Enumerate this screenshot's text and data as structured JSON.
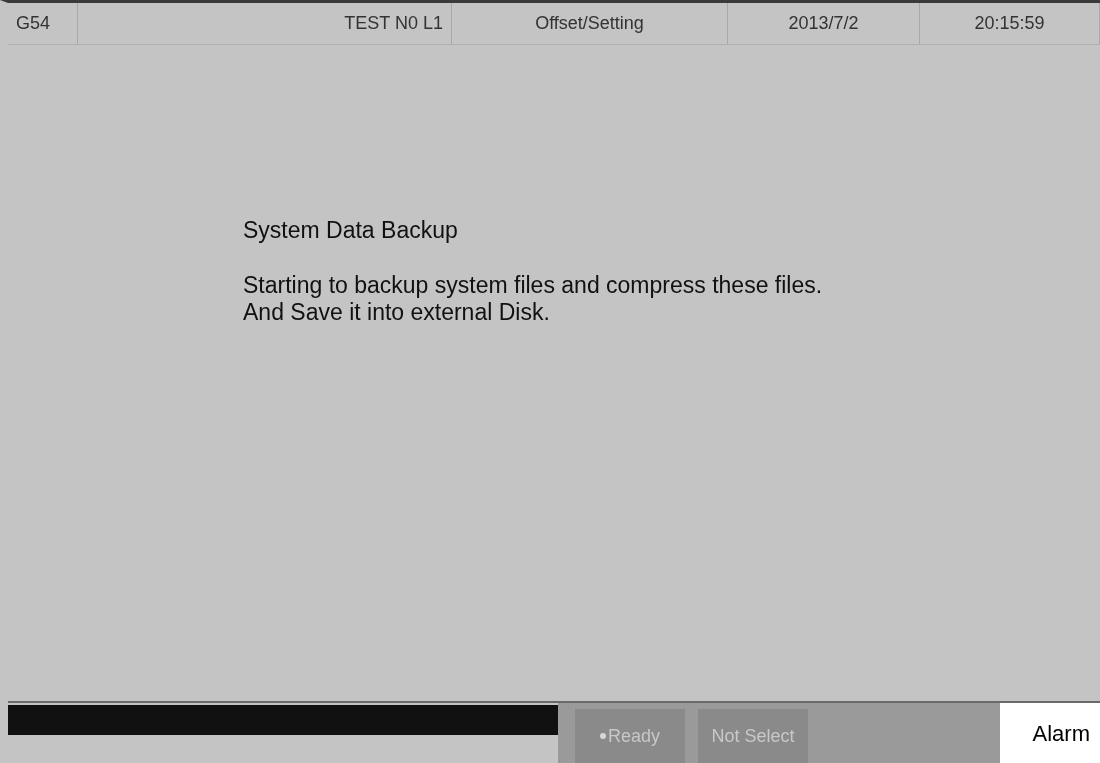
{
  "header": [
    "G54",
    "TEST N0 L1",
    "Offset/Setting",
    "2013/7/2",
    "20:15:59"
  ],
  "dialog": {
    "title": "System Data Backup",
    "lines": [
      "Starting to backup system files and compress these files.",
      "And Save it into external Disk."
    ]
  },
  "status": [
    {
      "text": "Ready",
      "dot": true
    },
    {
      "text": "Not Select",
      "dot": false
    }
  ],
  "alarm": "Alarm"
}
